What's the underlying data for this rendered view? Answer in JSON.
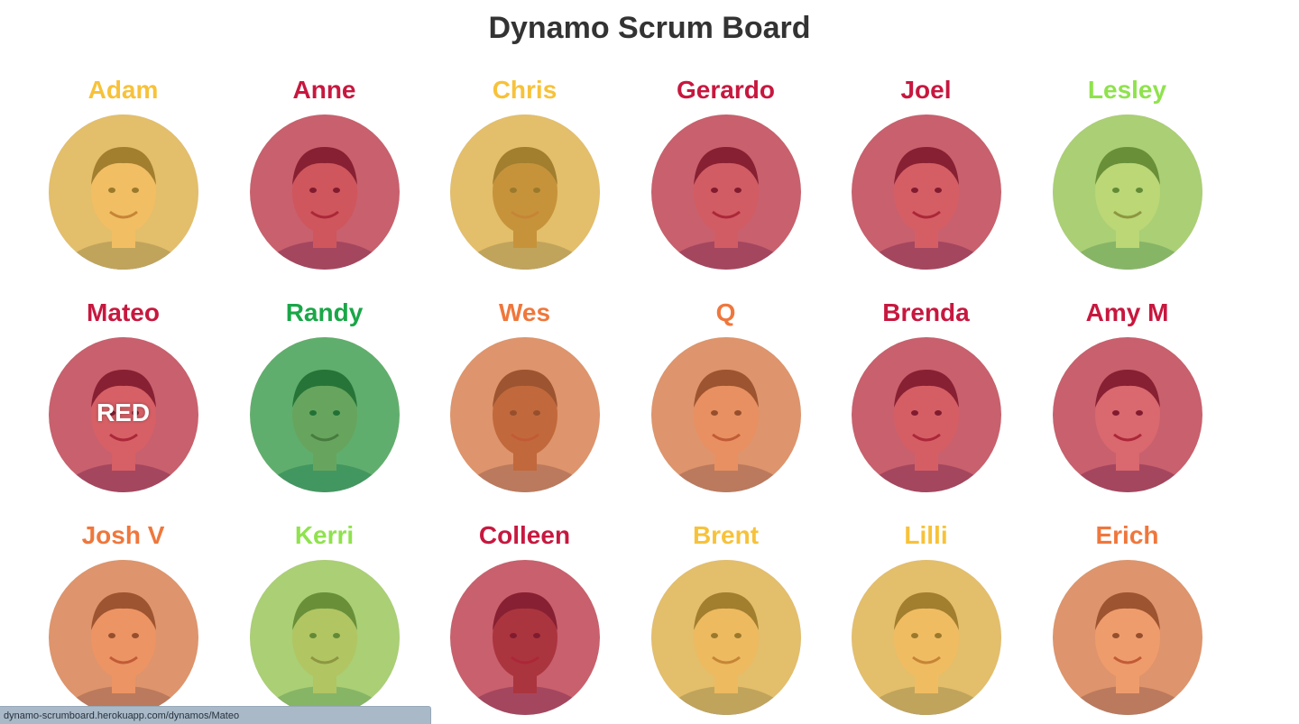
{
  "title": "Dynamo Scrum Board",
  "status_url": "dynamo-scrumboard.herokuapp.com/dynamos/Mateo",
  "colors": {
    "yellow": "#f7c23a",
    "red": "#c7183f",
    "green": "#1aa648",
    "lime": "#8fe24d",
    "orange": "#ef773c"
  },
  "members": [
    {
      "name": "Adam",
      "color": "yellow"
    },
    {
      "name": "Anne",
      "color": "red"
    },
    {
      "name": "Chris",
      "color": "yellow"
    },
    {
      "name": "Gerardo",
      "color": "red"
    },
    {
      "name": "Joel",
      "color": "red"
    },
    {
      "name": "Lesley",
      "color": "lime"
    },
    {
      "name": "Mateo",
      "color": "red",
      "overlay": "RED"
    },
    {
      "name": "Randy",
      "color": "green"
    },
    {
      "name": "Wes",
      "color": "orange"
    },
    {
      "name": "Q",
      "color": "orange"
    },
    {
      "name": "Brenda",
      "color": "red"
    },
    {
      "name": "Amy M",
      "color": "red"
    },
    {
      "name": "Josh V",
      "color": "orange"
    },
    {
      "name": "Kerri",
      "color": "lime"
    },
    {
      "name": "Colleen",
      "color": "red"
    },
    {
      "name": "Brent",
      "color": "yellow"
    },
    {
      "name": "Lilli",
      "color": "yellow"
    },
    {
      "name": "Erich",
      "color": "orange"
    }
  ]
}
